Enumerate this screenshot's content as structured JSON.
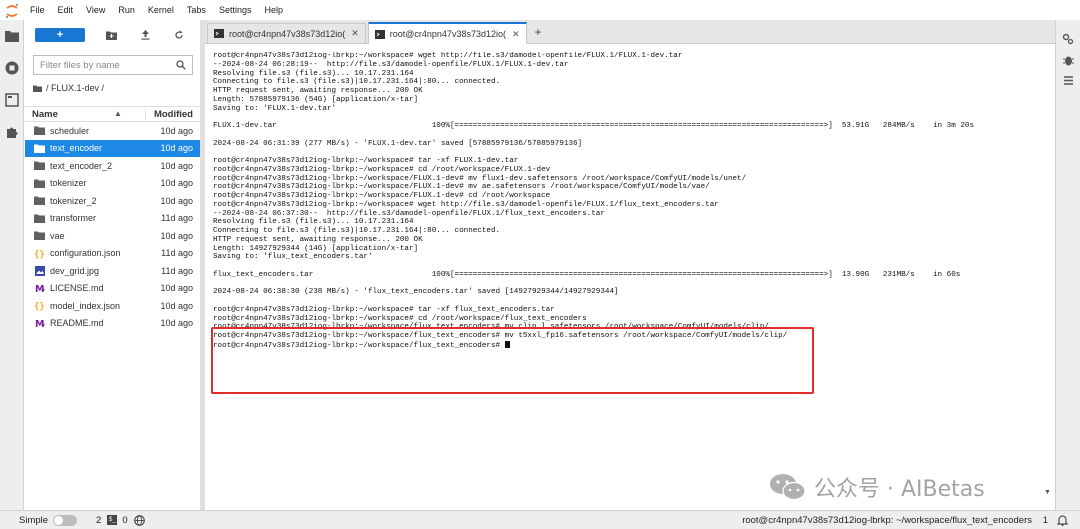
{
  "menu": [
    "File",
    "Edit",
    "View",
    "Run",
    "Kernel",
    "Tabs",
    "Settings",
    "Help"
  ],
  "browser": {
    "new_label": "+",
    "filter_placeholder": "Filter files by name",
    "breadcrumb": "/ FLUX.1-dev /",
    "col_name": "Name",
    "col_modified": "Modified",
    "files": [
      {
        "name": "scheduler",
        "modified": "10d ago",
        "icon": "folder-icon",
        "selected": false
      },
      {
        "name": "text_encoder",
        "modified": "10d ago",
        "icon": "folder-icon",
        "selected": true
      },
      {
        "name": "text_encoder_2",
        "modified": "10d ago",
        "icon": "folder-icon",
        "selected": false
      },
      {
        "name": "tokenizer",
        "modified": "10d ago",
        "icon": "folder-icon",
        "selected": false
      },
      {
        "name": "tokenizer_2",
        "modified": "10d ago",
        "icon": "folder-icon",
        "selected": false
      },
      {
        "name": "transformer",
        "modified": "11d ago",
        "icon": "folder-icon",
        "selected": false
      },
      {
        "name": "vae",
        "modified": "10d ago",
        "icon": "folder-icon",
        "selected": false
      },
      {
        "name": "configuration.json",
        "modified": "11d ago",
        "icon": "json-icon",
        "selected": false
      },
      {
        "name": "dev_grid.jpg",
        "modified": "11d ago",
        "icon": "image-icon",
        "selected": false
      },
      {
        "name": "LICENSE.md",
        "modified": "10d ago",
        "icon": "markdown-icon",
        "selected": false
      },
      {
        "name": "model_index.json",
        "modified": "10d ago",
        "icon": "json-icon",
        "selected": false
      },
      {
        "name": "README.md",
        "modified": "10d ago",
        "icon": "markdown-icon",
        "selected": false
      }
    ]
  },
  "tabs": [
    {
      "label": "root@cr4npn47v38s73d12io(",
      "active": false
    },
    {
      "label": "root@cr4npn47v38s73d12io(",
      "active": true
    }
  ],
  "terminal": {
    "lines": [
      "root@cr4npn47v38s73d12iog-lbrkp:~/workspace# wget http://file.s3/damodel-openfile/FLUX.1/FLUX.1-dev.tar",
      "--2024-08-24 06:28:19--  http://file.s3/damodel-openfile/FLUX.1/FLUX.1-dev.tar",
      "Resolving file.s3 (file.s3)... 10.17.231.164",
      "Connecting to file.s3 (file.s3)|10.17.231.164|:80... connected.",
      "HTTP request sent, awaiting response... 200 OK",
      "Length: 57885979136 (54G) [application/x-tar]",
      "Saving to: 'FLUX.1-dev.tar'",
      "",
      "FLUX.1-dev.tar                                  100%[=================================================================================>]  53.91G   284MB/s    in 3m 20s",
      "",
      "2024-08-24 06:31:39 (277 MB/s) - 'FLUX.1-dev.tar' saved [57885979136/57885979136]",
      "",
      "root@cr4npn47v38s73d12iog-lbrkp:~/workspace# tar -xf FLUX.1-dev.tar",
      "root@cr4npn47v38s73d12iog-lbrkp:~/workspace# cd /root/workspace/FLUX.1-dev",
      "root@cr4npn47v38s73d12iog-lbrkp:~/workspace/FLUX.1-dev# mv flux1-dev.safetensors /root/workspace/ComfyUI/models/unet/",
      "root@cr4npn47v38s73d12iog-lbrkp:~/workspace/FLUX.1-dev# mv ae.safetensors /root/workspace/ComfyUI/models/vae/",
      "root@cr4npn47v38s73d12iog-lbrkp:~/workspace/FLUX.1-dev# cd /root/workspace",
      "root@cr4npn47v38s73d12iog-lbrkp:~/workspace# wget http://file.s3/damodel-openfile/FLUX.1/flux_text_encoders.tar",
      "--2024-08-24 06:37:30--  http://file.s3/damodel-openfile/FLUX.1/flux_text_encoders.tar",
      "Resolving file.s3 (file.s3)... 10.17.231.164",
      "Connecting to file.s3 (file.s3)|10.17.231.164|:80... connected.",
      "HTTP request sent, awaiting response... 200 OK",
      "Length: 14927929344 (14G) [application/x-tar]",
      "Saving to: 'flux_text_encoders.tar'",
      "",
      "flux_text_encoders.tar                          100%[=================================================================================>]  13.90G   231MB/s    in 60s",
      "",
      "2024-08-24 06:38:30 (238 MB/s) - 'flux_text_encoders.tar' saved [14927929344/14927929344]",
      "",
      "root@cr4npn47v38s73d12iog-lbrkp:~/workspace# tar -xf flux_text_encoders.tar",
      "root@cr4npn47v38s73d12iog-lbrkp:~/workspace# cd /root/workspace/flux_text_encoders",
      "root@cr4npn47v38s73d12iog-lbrkp:~/workspace/flux_text_encoders# mv clip_l.safetensors /root/workspace/ComfyUI/models/clip/",
      "root@cr4npn47v38s73d12iog-lbrkp:~/workspace/flux_text_encoders# mv t5xxl_fp16.safetensors /root/workspace/ComfyUI/models/clip/",
      "root@cr4npn47v38s73d12iog-lbrkp:~/workspace/flux_text_encoders# "
    ]
  },
  "statusbar": {
    "mode_label": "Simple",
    "kernel_count": "2",
    "terminal_count": "0",
    "path": "root@cr4npn47v38s73d12iog-lbrkp: ~/workspace/flux_text_encoders",
    "notif_count": "1"
  },
  "watermark": "公众号 · AIBetas"
}
